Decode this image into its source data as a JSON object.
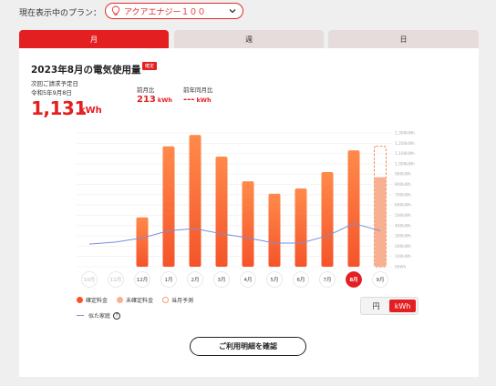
{
  "plan": {
    "label": "現在表示中のプラン：",
    "selected": "アクアエナジー１００",
    "icon": "lightbulb-icon"
  },
  "tabs": [
    {
      "label": "月",
      "active": true
    },
    {
      "label": "週",
      "active": false
    },
    {
      "label": "日",
      "active": false
    }
  ],
  "summary": {
    "title": "2023年8月の電気使用量",
    "badge": "確定",
    "billing_label": "次回ご請求予定日",
    "billing_date": "令和5年9月8日",
    "usage_value": "1,131",
    "usage_unit": "kWh",
    "prev_month_label": "前月比",
    "prev_month_value": "213",
    "prev_month_unit": "kWh",
    "prev_year_label": "前年同月比",
    "prev_year_value": "---",
    "prev_year_unit": "kWh"
  },
  "chart_data": {
    "type": "bar",
    "categories": [
      "10月",
      "11月",
      "12月",
      "1月",
      "2月",
      "3月",
      "4月",
      "5月",
      "6月",
      "7月",
      "8月",
      "9月"
    ],
    "series": [
      {
        "name": "確定料金",
        "values": [
          null,
          null,
          480,
          1170,
          1280,
          1070,
          830,
          710,
          760,
          920,
          1131,
          null
        ]
      },
      {
        "name": "当月予測",
        "values": [
          null,
          null,
          null,
          null,
          null,
          null,
          null,
          null,
          null,
          null,
          null,
          1170
        ]
      },
      {
        "name": "未確定料金",
        "values": [
          null,
          null,
          null,
          null,
          null,
          null,
          null,
          null,
          null,
          null,
          null,
          870
        ]
      },
      {
        "name": "似た家庭",
        "values": [
          220,
          240,
          280,
          350,
          370,
          320,
          280,
          230,
          230,
          300,
          420,
          350
        ]
      }
    ],
    "selected_category": "8月",
    "y_ticks": [
      "0kWh",
      "100kWh",
      "200kWh",
      "300kWh",
      "400kWh",
      "500kWh",
      "600kWh",
      "700kWh",
      "800kWh",
      "900kWh",
      "1,000kWh",
      "1,100kWh",
      "1,200kWh",
      "1,300kWh"
    ],
    "ylim": [
      0,
      1300
    ],
    "grid": true,
    "colors": {
      "confirmed": "#f5542a",
      "confirmed_top": "#ff8a4a",
      "unconfirmed": "#f7b191",
      "forecast_border": "#f07a3a",
      "similar_line": "#7b8ed9"
    }
  },
  "legend": {
    "confirmed": "確定料金",
    "unconfirmed": "未確定料金",
    "forecast": "当月予測",
    "similar": "似た家庭"
  },
  "unit_toggle": {
    "yen": "円",
    "kwh": "kWh",
    "selected": "kWh"
  },
  "detail_button": "ご利用明細を確認"
}
